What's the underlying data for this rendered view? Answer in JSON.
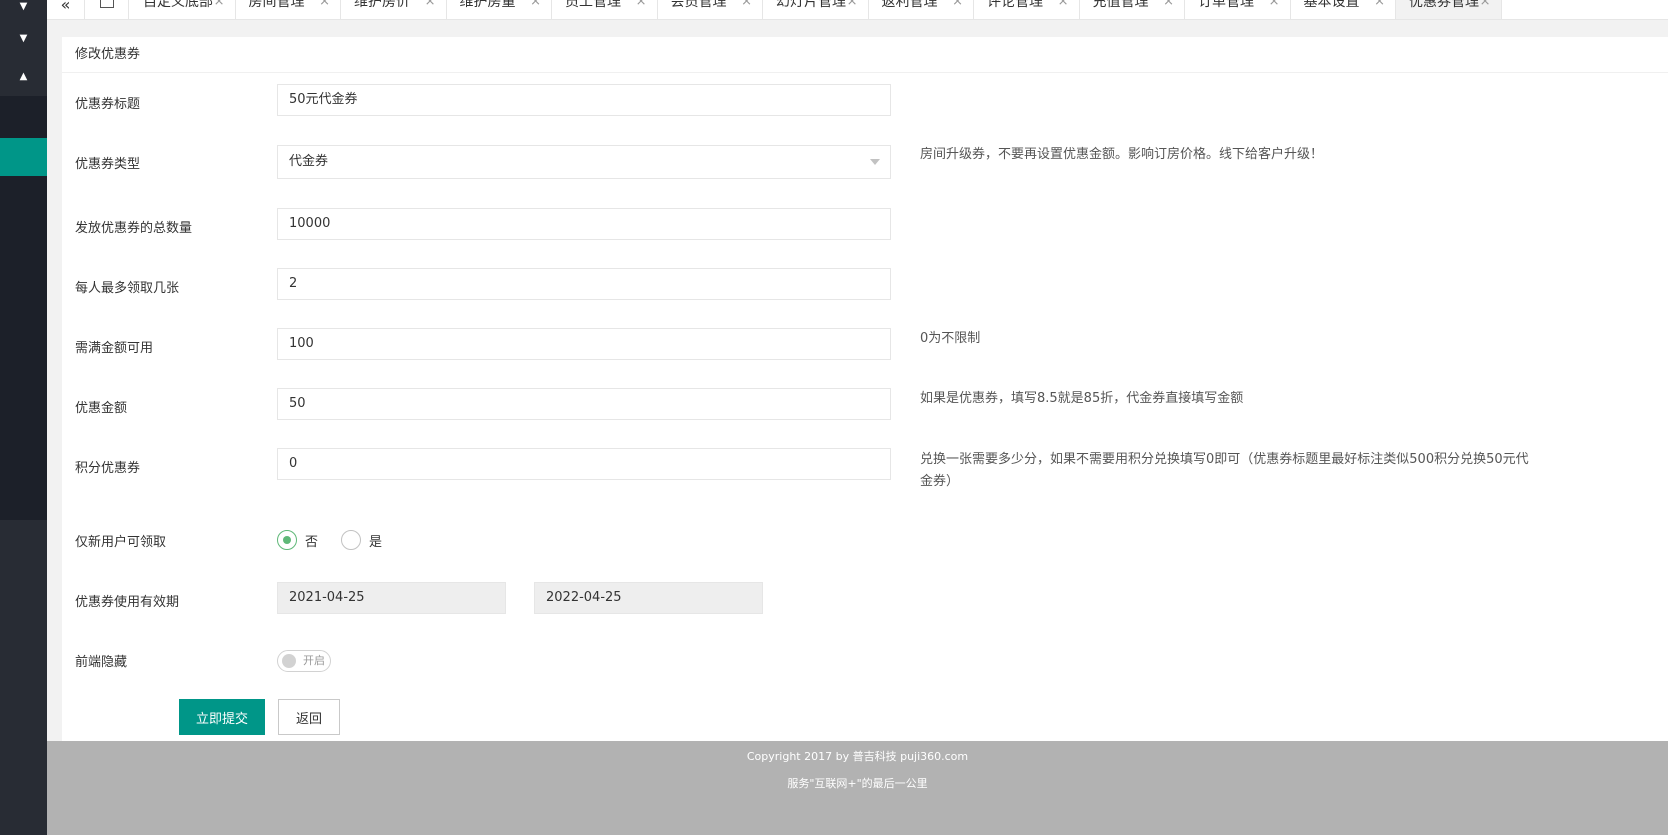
{
  "tabs": {
    "items": [
      "自定义底部",
      "房间管理",
      "维护房价",
      "维护房量",
      "员工管理",
      "会员管理",
      "幻灯片管理",
      "返利管理",
      "评论管理",
      "充值管理",
      "订单管理",
      "基本设置",
      "优惠券管理"
    ],
    "close_glyph": "×",
    "nav_left_glyph": "«"
  },
  "panel": {
    "title": "修改优惠券"
  },
  "form": {
    "title": {
      "label": "优惠券标题",
      "value": "50元代金券"
    },
    "type": {
      "label": "优惠券类型",
      "value": "代金券",
      "hint": "房间升级券，不要再设置优惠金额。影响订房价格。线下给客户升级！"
    },
    "total": {
      "label": "发放优惠券的总数量",
      "value": "10000"
    },
    "per_person": {
      "label": "每人最多领取几张",
      "value": "2"
    },
    "min_amount": {
      "label": "需满金额可用",
      "value": "100",
      "hint": "0为不限制"
    },
    "discount": {
      "label": "优惠金额",
      "value": "50",
      "hint": "如果是优惠券，填写8.5就是85折，代金券直接填写金额"
    },
    "points": {
      "label": "积分优惠券",
      "value": "0",
      "hint_line1": "兑换一张需要多少分，如果不需要用积分兑换填写0即可（优惠券标题里最好标注类似500积分兑换50元代",
      "hint_line2": "金券）"
    },
    "new_user_only": {
      "label": "仅新用户可领取",
      "option_no": "否",
      "option_yes": "是",
      "selected": "否"
    },
    "validity": {
      "label": "优惠券使用有效期",
      "start": "2021-04-25",
      "end": "2022-04-25"
    },
    "hide_frontend": {
      "label": "前端隐藏",
      "switch_text": "开启"
    },
    "submit_label": "立即提交",
    "back_label": "返回"
  },
  "footer": {
    "copyright": "Copyright 2017 by 普吉科技 puji360.com",
    "slogan": "服务\"互联网+\"的最后一公里"
  },
  "colors": {
    "primary": "#009688",
    "radio_checked": "#5fb878",
    "sidebar": "#1c2029",
    "footer": "#b2b2b2"
  }
}
